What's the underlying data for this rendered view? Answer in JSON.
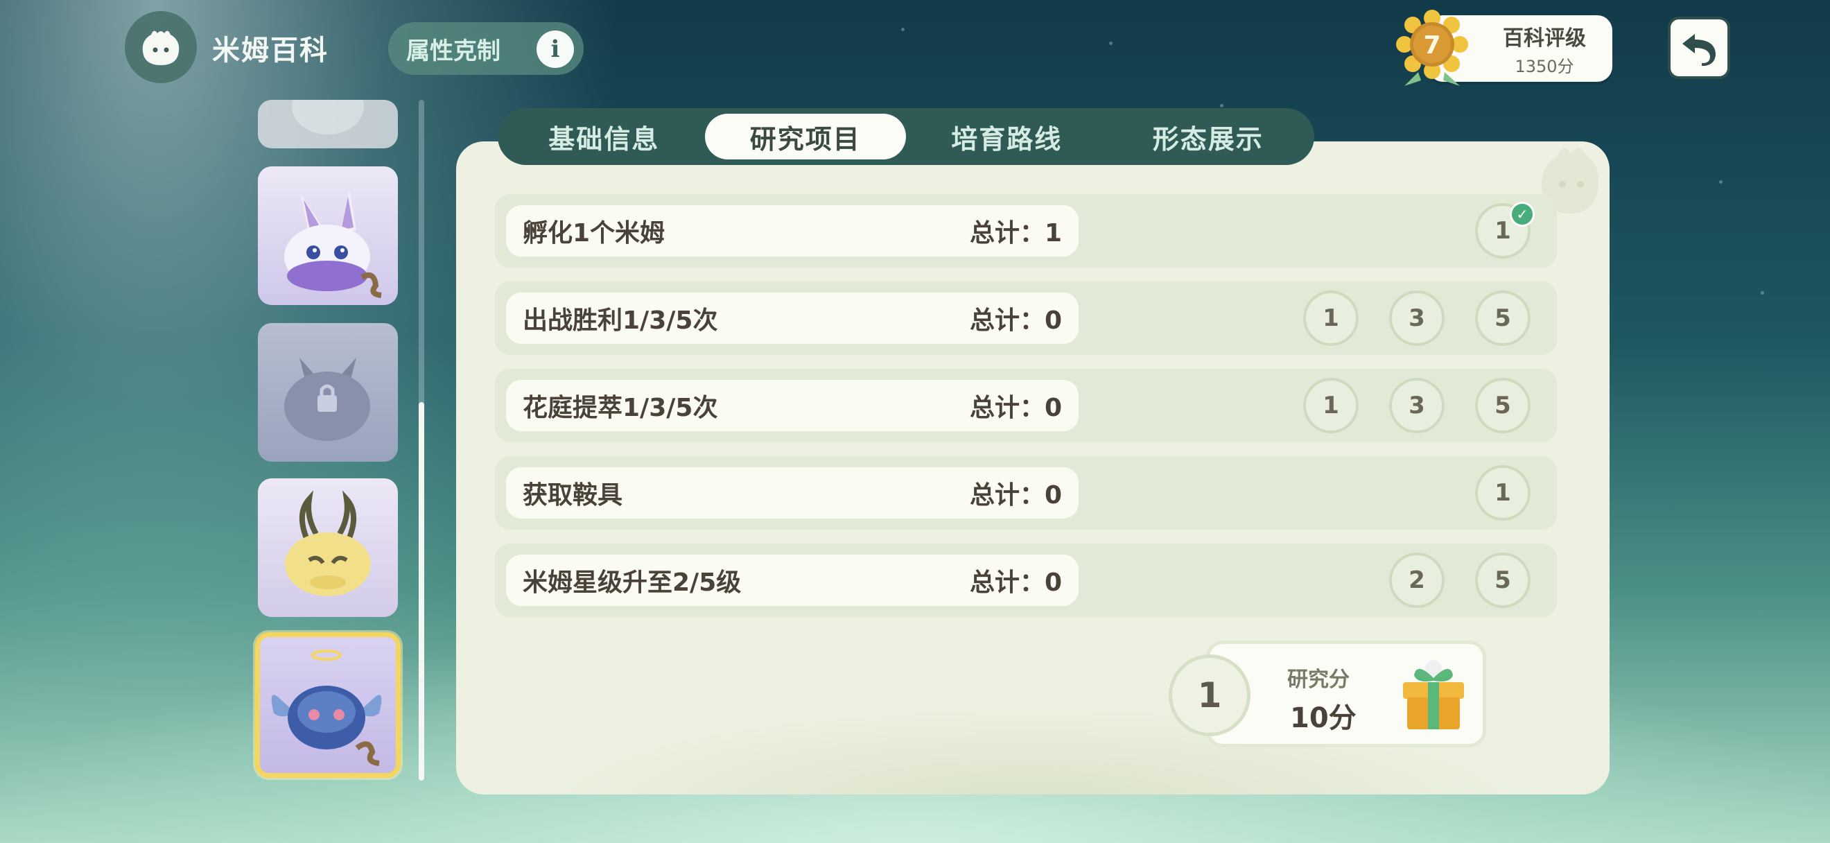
{
  "header": {
    "app_title": "米姆百科",
    "attribute_label": "属性克制",
    "info_glyph": "i",
    "rating_title": "百科评级",
    "rating_score": "1350分",
    "rating_level": "7"
  },
  "tabs": [
    {
      "label": "基础信息",
      "active": false
    },
    {
      "label": "研究项目",
      "active": true
    },
    {
      "label": "培育路线",
      "active": false
    },
    {
      "label": "形态展示",
      "active": false
    }
  ],
  "research": {
    "rows": [
      {
        "name": "孵化1个米姆",
        "total": "总计：1",
        "milestones": [
          {
            "value": "1",
            "done": true
          }
        ]
      },
      {
        "name": "出战胜利1/3/5次",
        "total": "总计：0",
        "milestones": [
          {
            "value": "1"
          },
          {
            "value": "3"
          },
          {
            "value": "5"
          }
        ]
      },
      {
        "name": "花庭提萃1/3/5次",
        "total": "总计：0",
        "milestones": [
          {
            "value": "1"
          },
          {
            "value": "3"
          },
          {
            "value": "5"
          }
        ]
      },
      {
        "name": "获取鞍具",
        "total": "总计：0",
        "milestones": [
          {
            "value": "1"
          }
        ]
      },
      {
        "name": "米姆星级升至2/5级",
        "total": "总计：0",
        "milestones": [
          {
            "value": "2"
          },
          {
            "value": "5"
          }
        ]
      }
    ]
  },
  "reward": {
    "level": "1",
    "label": "研究分",
    "value": "10分"
  },
  "icons": {
    "app": "mim-head-icon",
    "info": "info-icon",
    "back": "back-arrow-icon",
    "check": "check-icon",
    "gift": "gift-box-icon"
  },
  "colors": {
    "tab_bar": "#2f5a56",
    "panel": "#eef1e2",
    "selected_border": "#f3d560",
    "check": "#48ad7a"
  }
}
